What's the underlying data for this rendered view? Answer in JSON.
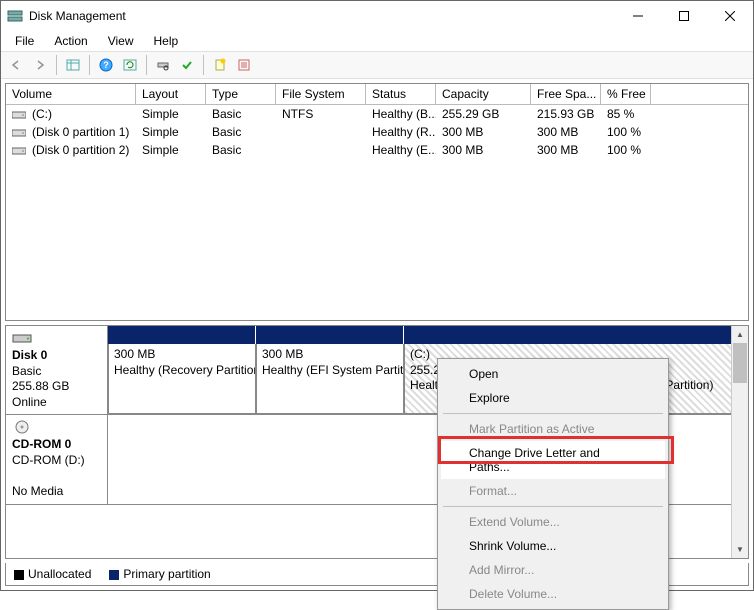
{
  "window": {
    "title": "Disk Management"
  },
  "menu": {
    "file": "File",
    "action": "Action",
    "view": "View",
    "help": "Help"
  },
  "columns": {
    "volume": "Volume",
    "layout": "Layout",
    "type": "Type",
    "fs": "File System",
    "status": "Status",
    "capacity": "Capacity",
    "free": "Free Spa...",
    "pct": "% Free"
  },
  "volumes": [
    {
      "name": "(C:)",
      "layout": "Simple",
      "type": "Basic",
      "fs": "NTFS",
      "status": "Healthy (B...",
      "capacity": "255.29 GB",
      "free": "215.93 GB",
      "pct": "85 %"
    },
    {
      "name": "(Disk 0 partition 1)",
      "layout": "Simple",
      "type": "Basic",
      "fs": "",
      "status": "Healthy (R...",
      "capacity": "300 MB",
      "free": "300 MB",
      "pct": "100 %"
    },
    {
      "name": "(Disk 0 partition 2)",
      "layout": "Simple",
      "type": "Basic",
      "fs": "",
      "status": "Healthy (E...",
      "capacity": "300 MB",
      "free": "300 MB",
      "pct": "100 %"
    }
  ],
  "disk0": {
    "label": "Disk 0",
    "kind": "Basic",
    "size": "255.88 GB",
    "state": "Online",
    "parts": [
      {
        "line1": "300 MB",
        "line2": "Healthy (Recovery Partition)"
      },
      {
        "line1": "300 MB",
        "line2": "Healthy (EFI System Partition)"
      },
      {
        "line1": "(C:)",
        "line2": "255.29 GB NTFS",
        "line3": "Healthy (Boot, Page File, Crash Dump, Primary Partition)"
      }
    ]
  },
  "cdrom": {
    "label": "CD-ROM 0",
    "sub": "CD-ROM (D:)",
    "state": "No Media"
  },
  "legend": {
    "unalloc": "Unallocated",
    "primary": "Primary partition",
    "color_unalloc": "#000000",
    "color_primary": "#0a246a"
  },
  "context": {
    "open": "Open",
    "explore": "Explore",
    "mark": "Mark Partition as Active",
    "change": "Change Drive Letter and Paths...",
    "format": "Format...",
    "extend": "Extend Volume...",
    "shrink": "Shrink Volume...",
    "mirror": "Add Mirror...",
    "delete": "Delete Volume..."
  }
}
